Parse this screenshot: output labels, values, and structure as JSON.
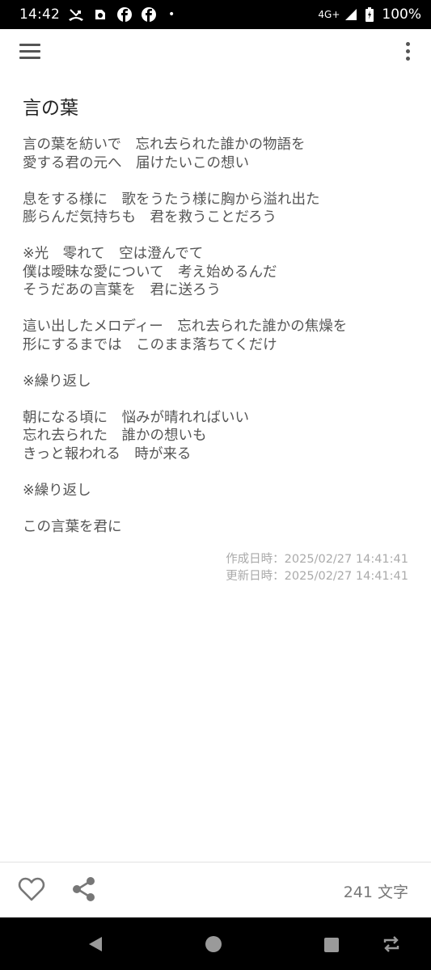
{
  "status_bar": {
    "time": "14:42",
    "network": "4G+",
    "battery": "100%",
    "dot": "•"
  },
  "note": {
    "title": "言の葉",
    "paragraphs": [
      [
        "言の葉を紡いで　忘れ去られた誰かの物語を",
        "愛する君の元へ　届けたいこの想い"
      ],
      [
        "息をする様に　歌をうたう様に胸から溢れ出た",
        "膨らんだ気持ちも　君を救うことだろう"
      ],
      [
        "※光　零れて　空は澄んでて",
        "僕は曖昧な愛について　考え始めるんだ",
        "そうだあの言葉を　君に送ろう"
      ],
      [
        "這い出したメロディー　忘れ去られた誰かの焦燥を",
        "形にするまでは　このまま落ちてくだけ"
      ],
      [
        "※繰り返し"
      ],
      [
        "朝になる頃に　悩みが晴れればいい",
        "忘れ去られた　誰かの想いも",
        "きっと報われる　時が来る"
      ],
      [
        "※繰り返し"
      ],
      [
        "この言葉を君に"
      ]
    ],
    "created": "作成日時：2025/02/27 14:41:41",
    "updated": "更新日時：2025/02/27 14:41:41"
  },
  "toolbar": {
    "char_count": "241 文字",
    "like_icon": "heart-icon",
    "share_icon": "share-icon"
  },
  "colors": {
    "status_bg": "#000000",
    "text": "#555555",
    "meta": "#aaaaaa"
  }
}
